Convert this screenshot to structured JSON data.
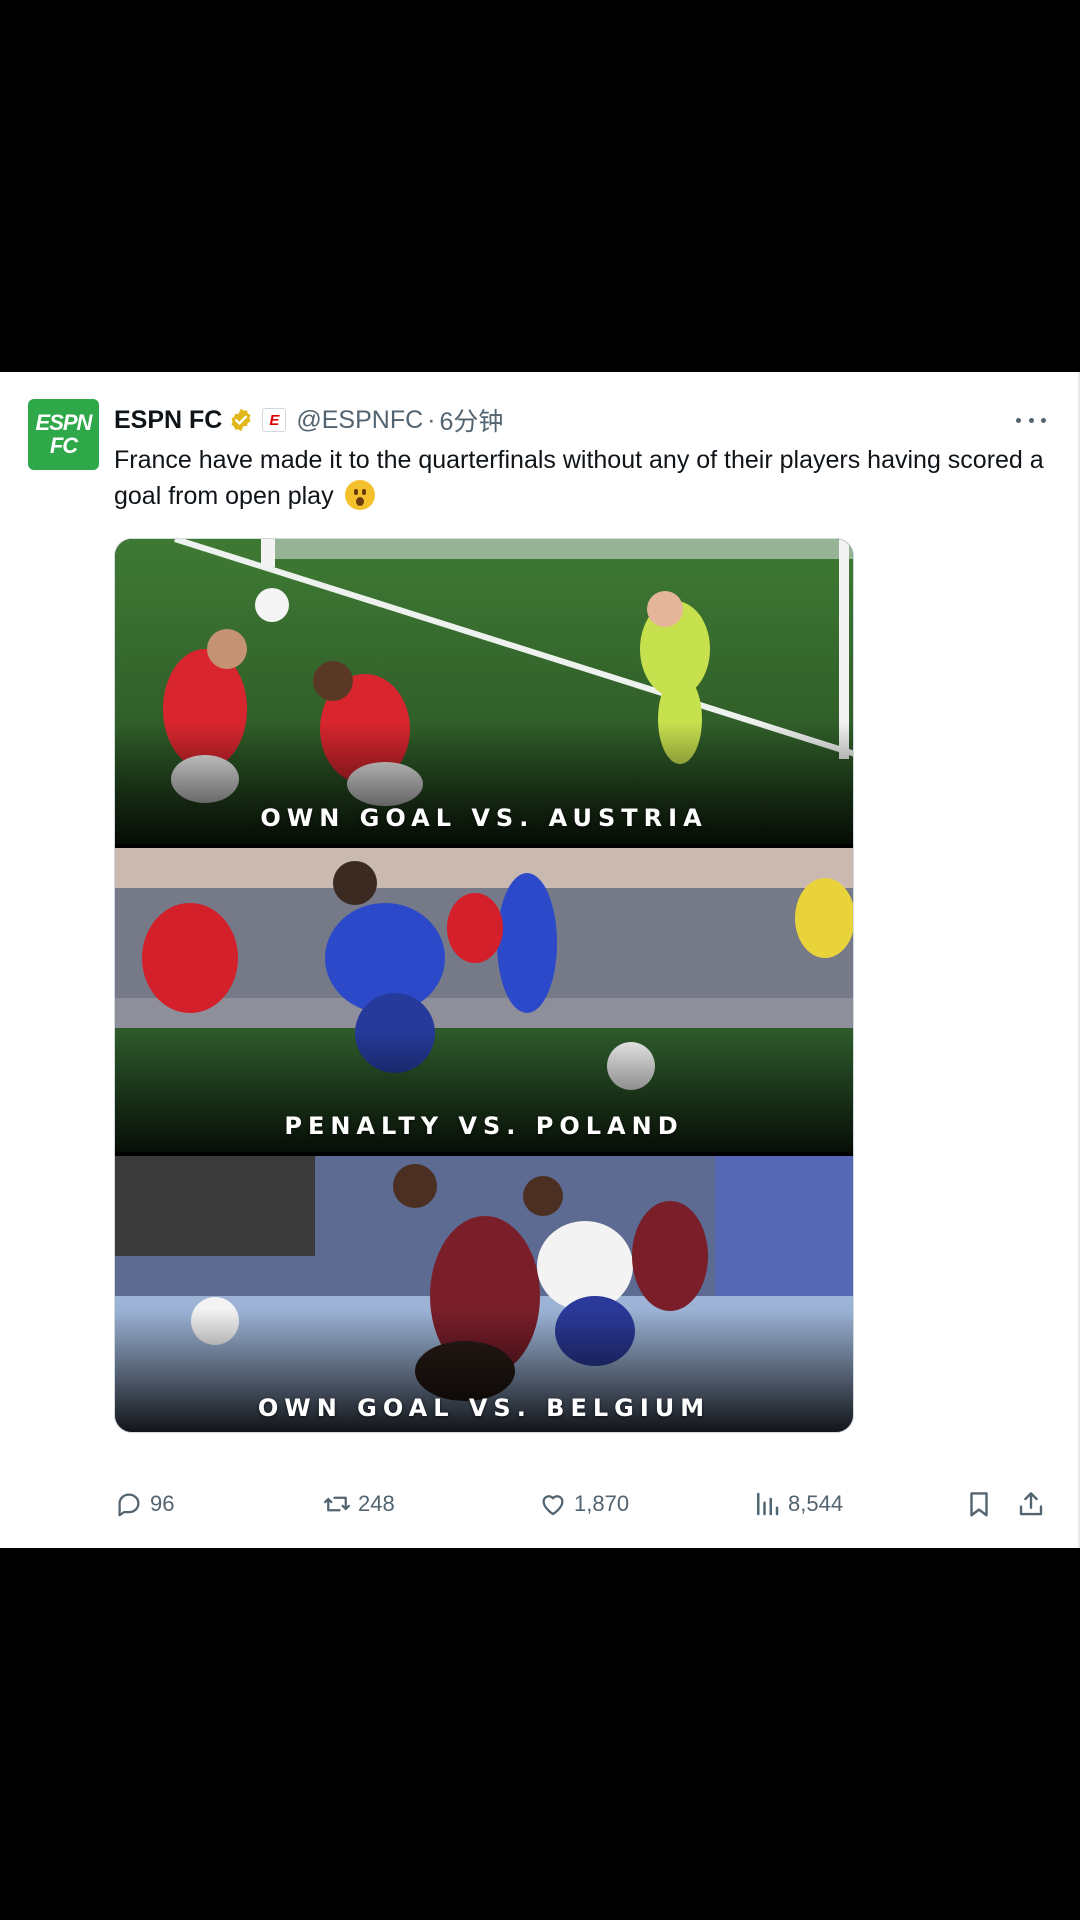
{
  "tweet": {
    "avatar": {
      "line1": "ESPN",
      "line2": "FC"
    },
    "display_name": "ESPN FC",
    "affiliate_badge": "E",
    "handle": "@ESPNFC",
    "separator": "·",
    "timestamp": "6分钟",
    "text": "France have made it to the quarterfinals without any of their players having scored a goal from open play",
    "emoji": "astonished-face-emoji",
    "media": {
      "panels": [
        {
          "caption": "OWN GOAL VS. AUSTRIA"
        },
        {
          "caption": "PENALTY VS. POLAND"
        },
        {
          "caption": "OWN GOAL VS. BELGIUM"
        }
      ]
    },
    "actions": {
      "replies": "96",
      "retweets": "248",
      "likes": "1,870",
      "views": "8,544"
    }
  },
  "icons": {
    "verified": "verified-gold-badge-icon",
    "more": "more-options-icon",
    "reply": "reply-icon",
    "retweet": "retweet-icon",
    "like": "heart-icon",
    "views": "views-bar-chart-icon",
    "bookmark": "bookmark-icon",
    "share": "share-icon"
  },
  "colors": {
    "brand_green": "#2fa84a",
    "verified_gold": "#e2b719",
    "text_primary": "#0f1419",
    "text_secondary": "#536471"
  }
}
